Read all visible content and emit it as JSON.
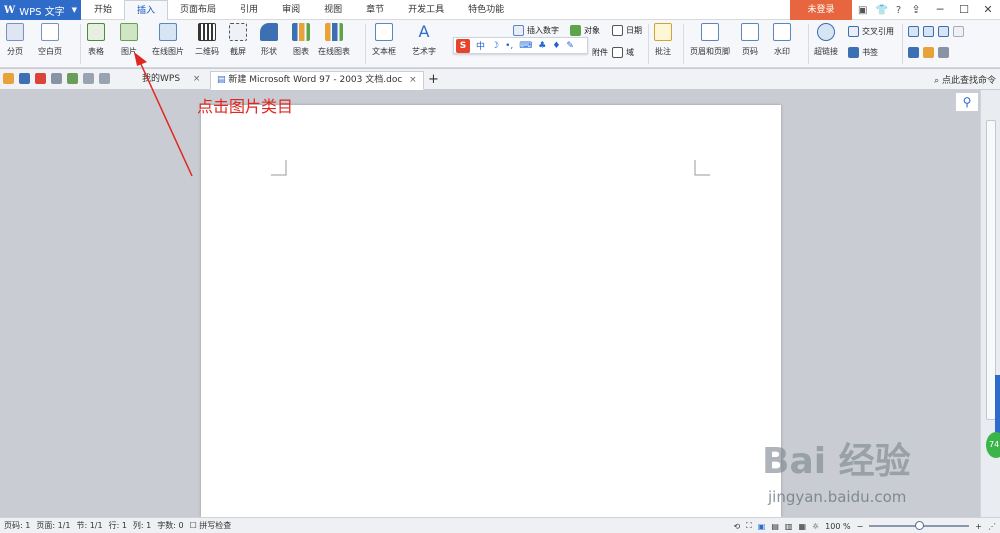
{
  "app": {
    "name": "WPS 文字",
    "logo": "W"
  },
  "menu_tabs": [
    "开始",
    "插入",
    "页面布局",
    "引用",
    "审阅",
    "视图",
    "章节",
    "开发工具",
    "特色功能"
  ],
  "active_tab": "插入",
  "login": "未登录",
  "help_glyph": "?",
  "ribbon": {
    "page_break": "分页",
    "blank_page": "空白页",
    "table": "表格",
    "picture": "图片",
    "online_picture": "在线图片",
    "qr_code": "二维码",
    "screenshot": "截屏",
    "shapes": "形状",
    "chart": "图表",
    "online_chart": "在线图表",
    "textbox": "文本框",
    "wordart": "艺术字",
    "insert_number": "插入数字",
    "object": "对象",
    "date": "日期",
    "attachment": "附件",
    "field": "域",
    "comment": "批注",
    "header_footer": "页眉和页脚",
    "page_number": "页码",
    "watermark": "水印",
    "hyperlink": "超链接",
    "cross_ref": "交叉引用",
    "bookmark": "书签"
  },
  "ime": {
    "logo": "S",
    "mode": "中"
  },
  "doc_tabs": [
    {
      "label": "我的WPS"
    },
    {
      "label": "新建 Microsoft Word 97 - 2003 文档.doc"
    }
  ],
  "find_command": "点此查找命令",
  "annotation": "点击图片类目",
  "speed_badge": "74",
  "watermark": {
    "brand": "Bai 经验",
    "url": "jingyan.baidu.com"
  },
  "status": {
    "page_code": "页码: 1",
    "pages": "页面: 1/1",
    "section": "节: 1/1",
    "row": "行: 1",
    "col": "列: 1",
    "word_count": "字数: 0",
    "spellcheck": "拼写检查",
    "zoom": "100 %",
    "zoom_fraction": 0.5
  },
  "colors": {
    "accent": "#2f6bc9",
    "login_bg": "#e8663f",
    "annotation": "#e0271f"
  }
}
